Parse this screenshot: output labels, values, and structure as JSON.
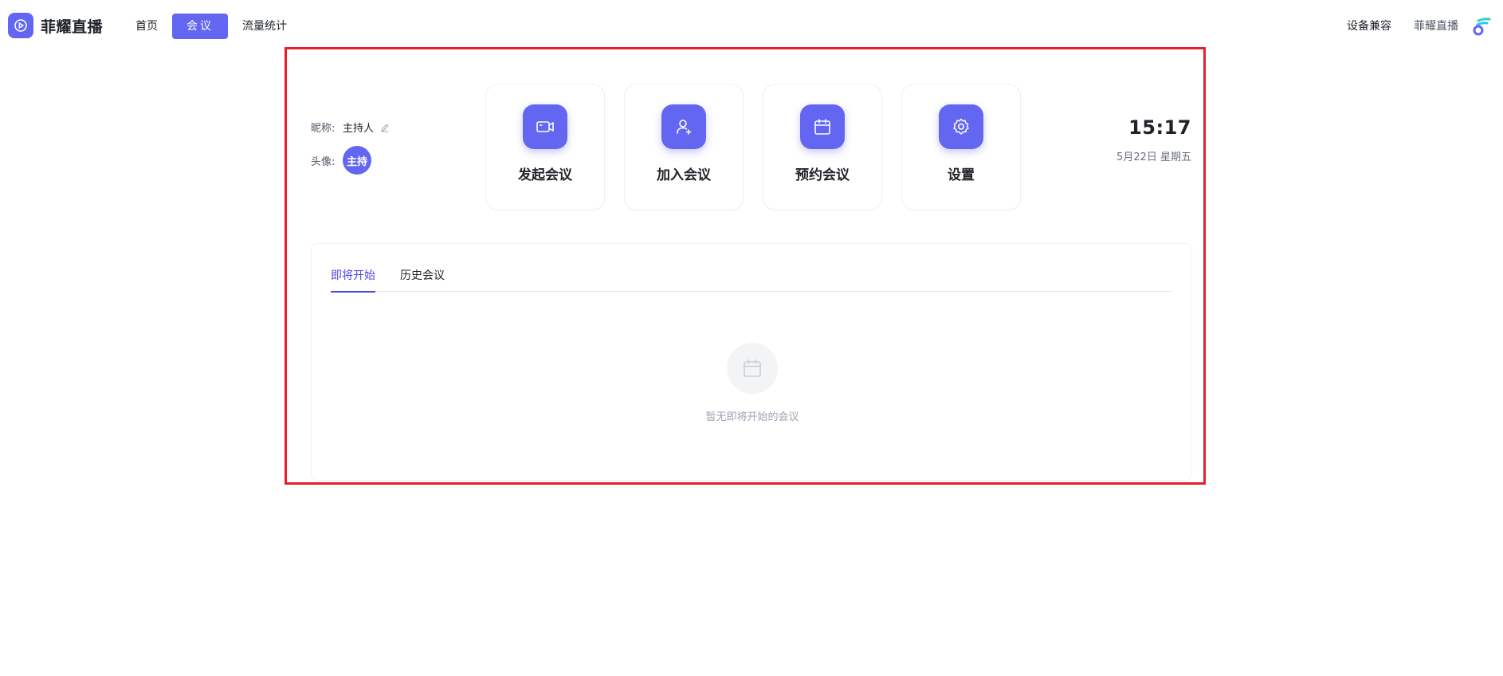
{
  "brand": {
    "name": "菲耀直播",
    "icon": "play-circle-icon",
    "color": "#6366f1"
  },
  "nav": {
    "items": [
      {
        "label": "首页",
        "active": false
      },
      {
        "label": "会议",
        "active": true
      },
      {
        "label": "流量统计",
        "active": false
      }
    ],
    "right": {
      "compat_label": "设备兼容",
      "brand_label": "菲耀直播",
      "icon": "brand-swirl-icon"
    }
  },
  "profile": {
    "nickname_label": "昵称:",
    "nickname_value": "主持人",
    "avatar_label": "头像:",
    "avatar_text": "主持"
  },
  "actions": [
    {
      "label": "发起会议",
      "icon": "video-camera-icon"
    },
    {
      "label": "加入会议",
      "icon": "user-add-icon"
    },
    {
      "label": "预约会议",
      "icon": "calendar-icon"
    },
    {
      "label": "设置",
      "icon": "gear-icon"
    }
  ],
  "clock": {
    "time": "15:17",
    "date": "5月22日 星期五"
  },
  "meetings": {
    "tabs": [
      {
        "label": "即将开始",
        "active": true
      },
      {
        "label": "历史会议",
        "active": false
      }
    ],
    "empty_text": "暂无即将开始的会议",
    "empty_icon": "calendar-icon"
  },
  "colors": {
    "accent": "#6366f1",
    "highlight_frame": "#e5202b"
  }
}
